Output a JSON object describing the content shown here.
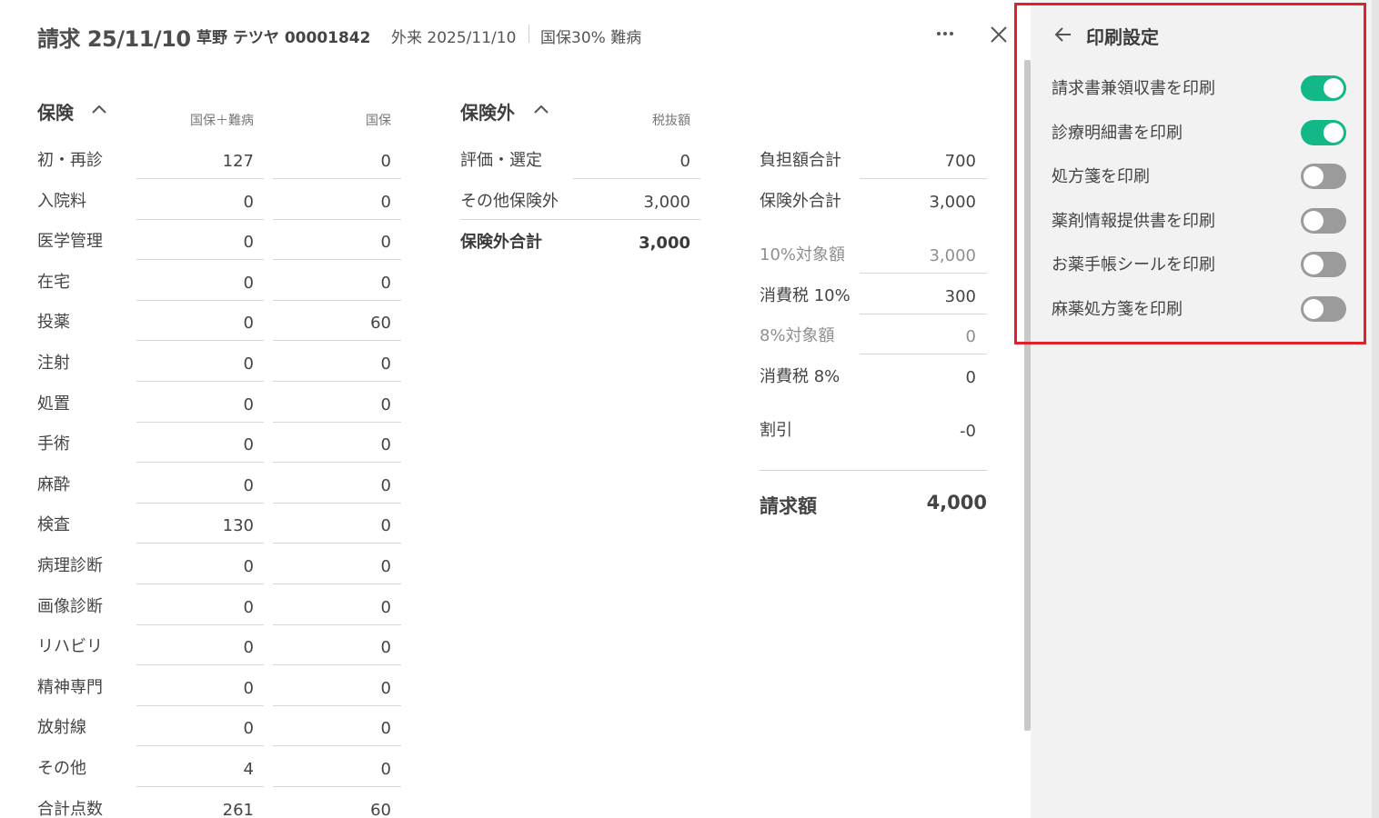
{
  "header": {
    "title": "請求 25/11/10",
    "patient": "草野 テツヤ  00001842",
    "visit": "外来 2025/11/10",
    "insurance": "国保30% 難病"
  },
  "insurance": {
    "title": "保険",
    "col1": "国保＋難病",
    "col2": "国保",
    "rows": [
      {
        "label": "初・再診",
        "v1": "127",
        "v2": "0"
      },
      {
        "label": "入院料",
        "v1": "0",
        "v2": "0"
      },
      {
        "label": "医学管理",
        "v1": "0",
        "v2": "0"
      },
      {
        "label": "在宅",
        "v1": "0",
        "v2": "0"
      },
      {
        "label": "投薬",
        "v1": "0",
        "v2": "60"
      },
      {
        "label": "注射",
        "v1": "0",
        "v2": "0"
      },
      {
        "label": "処置",
        "v1": "0",
        "v2": "0"
      },
      {
        "label": "手術",
        "v1": "0",
        "v2": "0"
      },
      {
        "label": "麻酔",
        "v1": "0",
        "v2": "0"
      },
      {
        "label": "検査",
        "v1": "130",
        "v2": "0"
      },
      {
        "label": "病理診断",
        "v1": "0",
        "v2": "0"
      },
      {
        "label": "画像診断",
        "v1": "0",
        "v2": "0"
      },
      {
        "label": "リハビリ",
        "v1": "0",
        "v2": "0"
      },
      {
        "label": "精神専門",
        "v1": "0",
        "v2": "0"
      },
      {
        "label": "放射線",
        "v1": "0",
        "v2": "0"
      },
      {
        "label": "その他",
        "v1": "4",
        "v2": "0"
      },
      {
        "label": "合計点数",
        "v1": "261",
        "v2": "60"
      }
    ]
  },
  "non_insurance": {
    "title": "保険外",
    "col": "税抜額",
    "rows": [
      {
        "label": "評価・選定",
        "value": "0"
      },
      {
        "label": "その他保険外",
        "value": "3,000"
      }
    ],
    "total_label": "保険外合計",
    "total_value": "3,000"
  },
  "summary": {
    "rows": [
      {
        "label": "負担額合計",
        "value": "700"
      },
      {
        "label": "保険外合計",
        "value": "3,000"
      },
      {
        "label": "10%対象額",
        "value": "3,000"
      },
      {
        "label": "消費税 10%",
        "value": "300"
      },
      {
        "label": "8%対象額",
        "value": "0"
      },
      {
        "label": "消費税 8%",
        "value": "0"
      },
      {
        "label": "割引",
        "value": "-0"
      }
    ],
    "grand_label": "請求額",
    "grand_value": "4,000"
  },
  "print_settings": {
    "title": "印刷設定",
    "options": [
      {
        "label": "請求書兼領収書を印刷",
        "on": true
      },
      {
        "label": "診療明細書を印刷",
        "on": true
      },
      {
        "label": "処方箋を印刷",
        "on": false
      },
      {
        "label": "薬剤情報提供書を印刷",
        "on": false
      },
      {
        "label": "お薬手帳シールを印刷",
        "on": false
      },
      {
        "label": "麻薬処方箋を印刷",
        "on": false
      }
    ],
    "colors": {
      "toggle_on": "#12b886",
      "toggle_off": "#9b9b9b",
      "highlight": "#e0202a"
    }
  },
  "icons": {
    "more": "more-horizontal-icon",
    "close": "close-icon",
    "back": "arrow-left-icon",
    "collapse": "chevron-up-icon"
  }
}
